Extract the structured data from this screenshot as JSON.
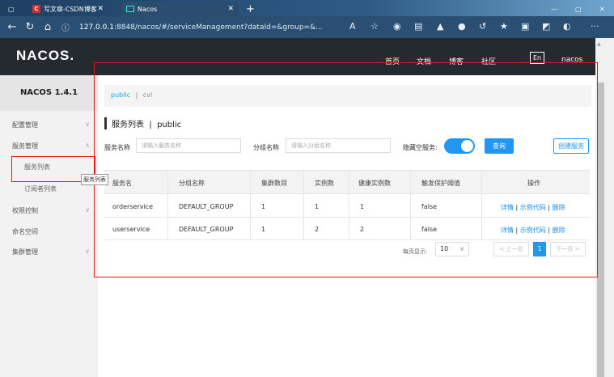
{
  "browser": {
    "tabs": [
      {
        "label": "写文章-CSDN博客"
      },
      {
        "label": "Nacos"
      }
    ],
    "url_host": "127.0.0.1",
    "url_rest": ":8848/nacos/#/serviceManagement?dataId=&group=&..."
  },
  "header": {
    "logo": "NACOS.",
    "nav": [
      "首页",
      "文档",
      "博客",
      "社区"
    ],
    "lang_btn": "En",
    "user": "nacos"
  },
  "sidebar": {
    "title": "NACOS 1.4.1",
    "items": [
      {
        "label": "配置管理"
      },
      {
        "label": "服务管理"
      },
      {
        "label": "服务列表"
      },
      {
        "label": "订阅者列表"
      },
      {
        "label": "权限控制"
      },
      {
        "label": "命名空间"
      },
      {
        "label": "集群管理"
      }
    ],
    "tooltip": "服务列表"
  },
  "main": {
    "namespaces": {
      "active": "public",
      "separator": "|",
      "other": "cvi"
    },
    "title": "服务列表  |  public",
    "filters": {
      "service_name_label": "服务名称",
      "service_name_placeholder": "请输入服务名称",
      "group_name_label": "分组名称",
      "group_name_placeholder": "请输入分组名称",
      "hide_empty_label": "隐藏空服务:",
      "hide_empty_on": true,
      "query_btn": "查询",
      "create_btn": "创建服务"
    },
    "table": {
      "columns": [
        "服务名",
        "分组名称",
        "集群数目",
        "实例数",
        "健康实例数",
        "触发保护阈值",
        "操作"
      ],
      "rows": [
        {
          "name": "orderservice",
          "group": "DEFAULT_GROUP",
          "clusters": "1",
          "instances": "1",
          "healthy": "1",
          "threshold": "false"
        },
        {
          "name": "userservice",
          "group": "DEFAULT_GROUP",
          "clusters": "1",
          "instances": "2",
          "healthy": "2",
          "threshold": "false"
        }
      ],
      "actions": {
        "detail": "详情",
        "sample": "示例代码",
        "delete": "删除",
        "sep": "|"
      }
    },
    "pagination": {
      "per_page_label": "每页显示:",
      "per_page": "10",
      "prev": "< 上一页",
      "current": "1",
      "next": "下一页 >"
    }
  },
  "colors": {
    "accent": "#2196f3",
    "header_bg": "#252a2f",
    "annotation": "#e01a1a"
  }
}
